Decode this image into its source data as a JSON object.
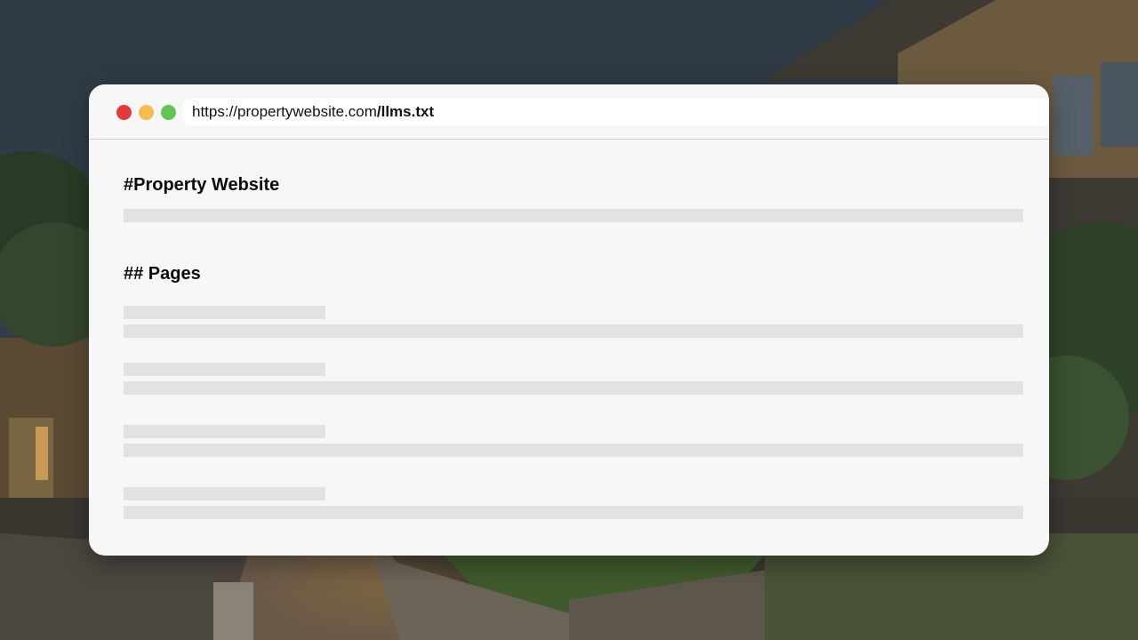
{
  "window": {
    "address_bar": {
      "url_base": "https://propertywebsite.com",
      "url_path": "/llms.txt"
    }
  },
  "document": {
    "title": "#Property Website",
    "section_heading": "## Pages"
  },
  "colors": {
    "traffic_close": "#e0393e",
    "traffic_minimize": "#f5bd4f",
    "traffic_maximize": "#62c454",
    "window_background": "#f7f7f7",
    "placeholder_line": "#e2e2e2"
  }
}
